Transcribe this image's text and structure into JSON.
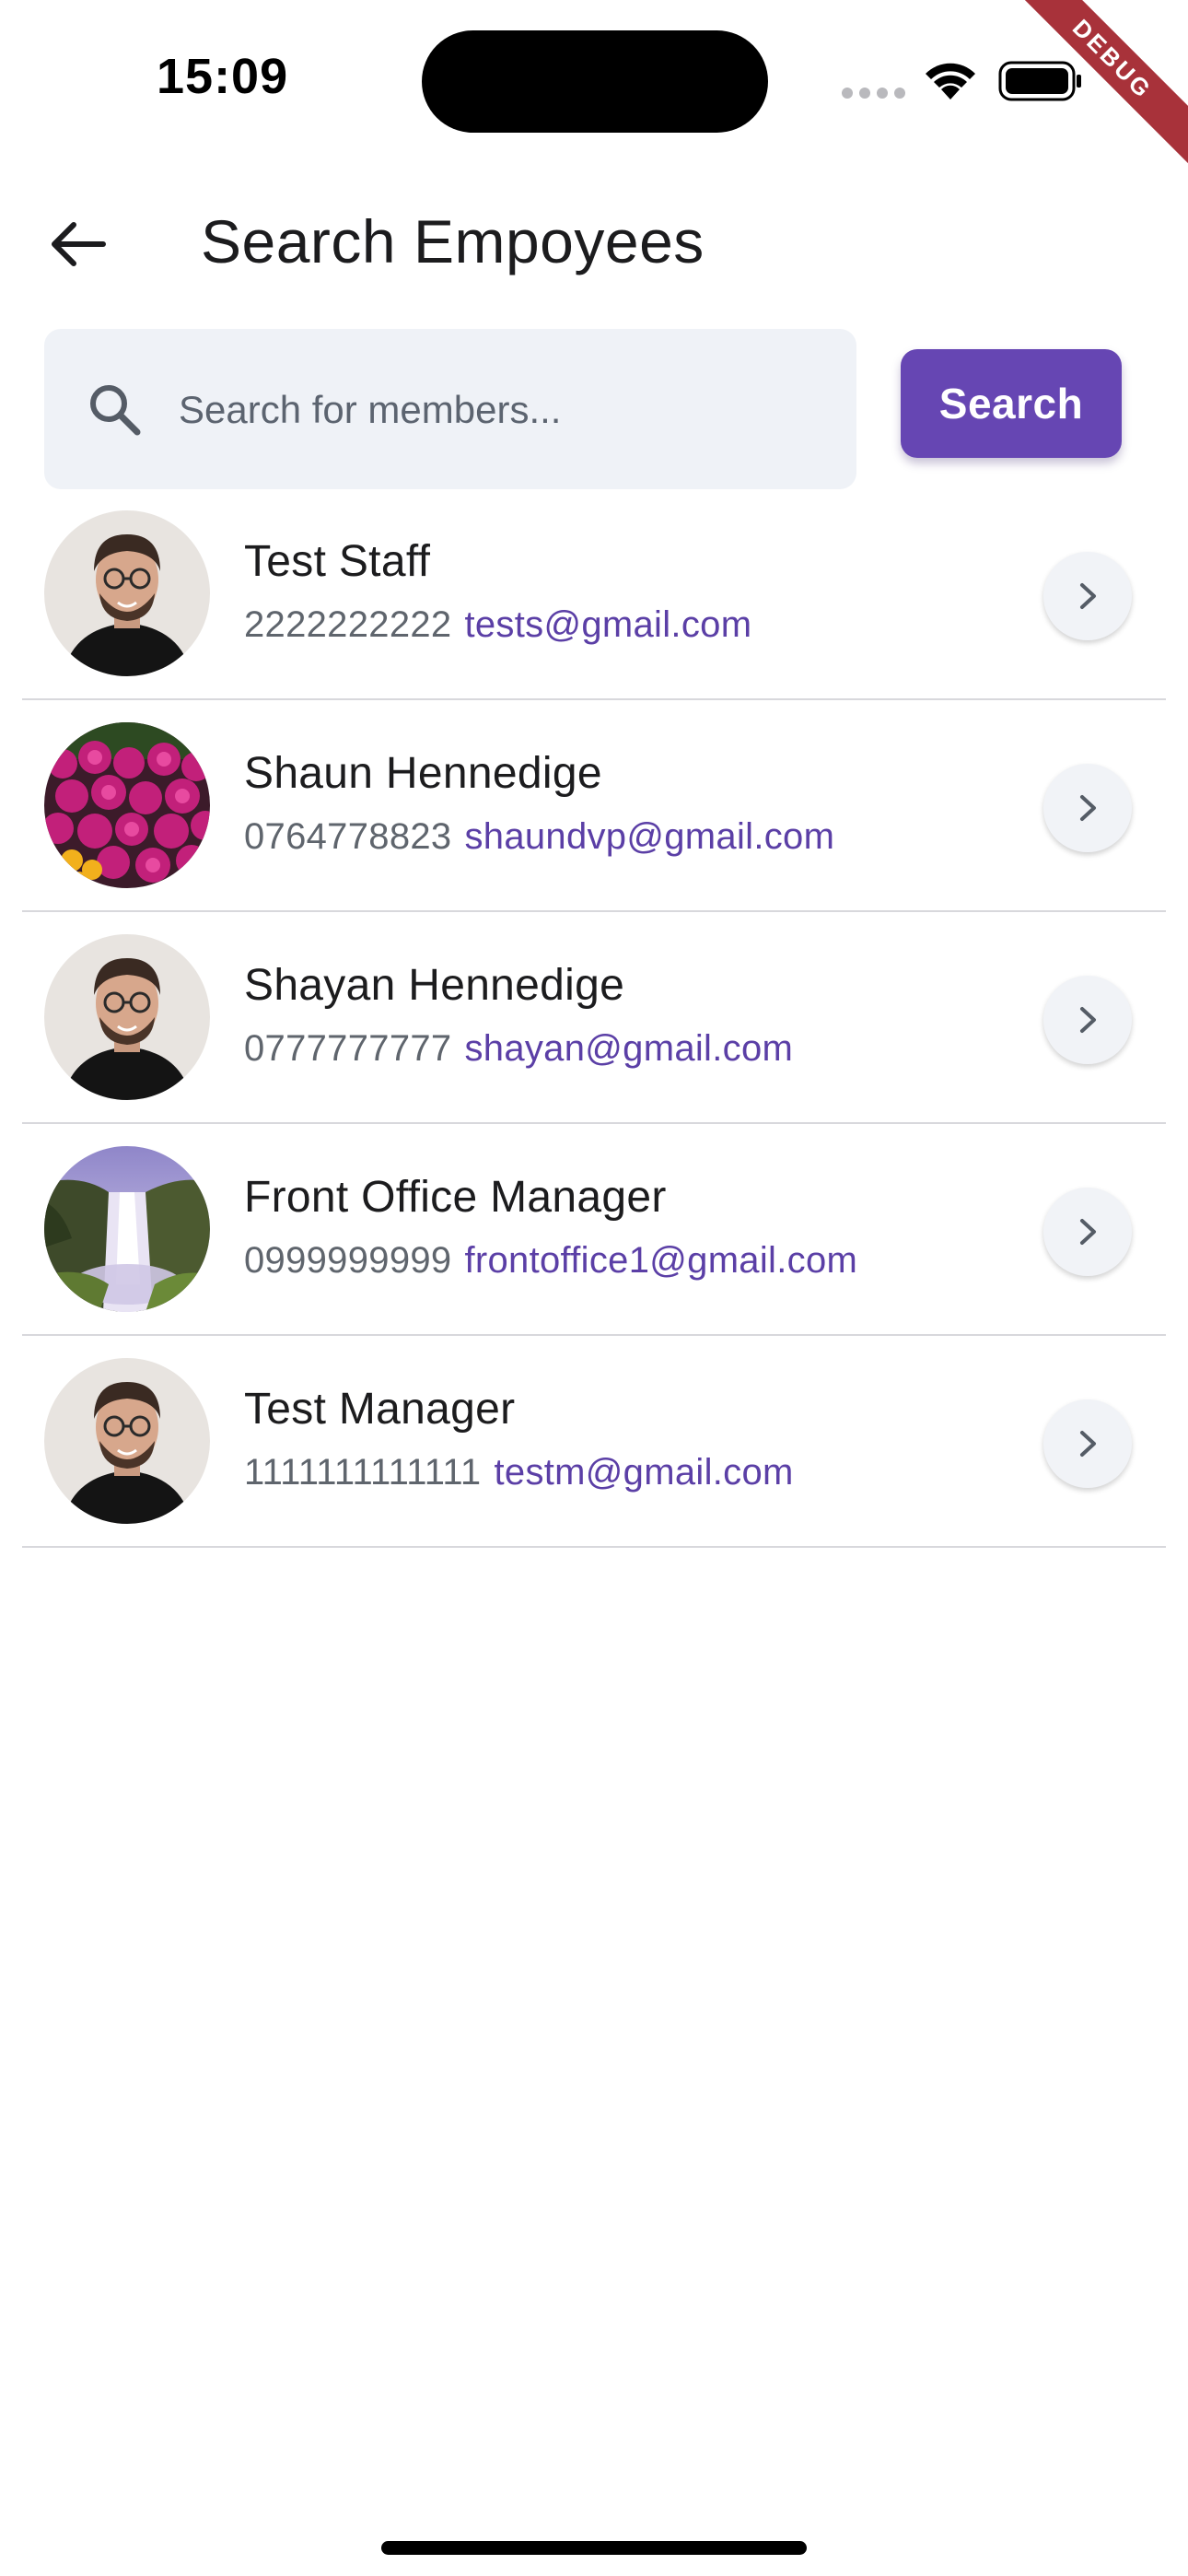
{
  "status_bar": {
    "time": "15:09",
    "debug_label": "DEBUG"
  },
  "app_bar": {
    "title": "Search Empoyees",
    "back_icon": "arrow-left-icon"
  },
  "search": {
    "placeholder": "Search for members...",
    "value": "",
    "button_label": "Search",
    "icon": "search-icon",
    "accent_color": "#6646b3"
  },
  "members": [
    {
      "name": "Test Staff",
      "phone": "2222222222",
      "email": "tests@gmail.com",
      "avatar": "man-portrait"
    },
    {
      "name": "Shaun Hennedige",
      "phone": "0764778823",
      "email": "shaundvp@gmail.com",
      "avatar": "pink-flowers"
    },
    {
      "name": "Shayan Hennedige",
      "phone": "0777777777",
      "email": "shayan@gmail.com",
      "avatar": "man-portrait"
    },
    {
      "name": "Front Office Manager",
      "phone": "0999999999",
      "email": "frontoffice1@gmail.com",
      "avatar": "waterfall"
    },
    {
      "name": "Test Manager",
      "phone": "1111111111111",
      "email": "testm@gmail.com",
      "avatar": "man-portrait"
    }
  ],
  "colors": {
    "email": "#5b3fa6",
    "phone": "#5f656d",
    "search_field_bg": "#eff2f7"
  }
}
